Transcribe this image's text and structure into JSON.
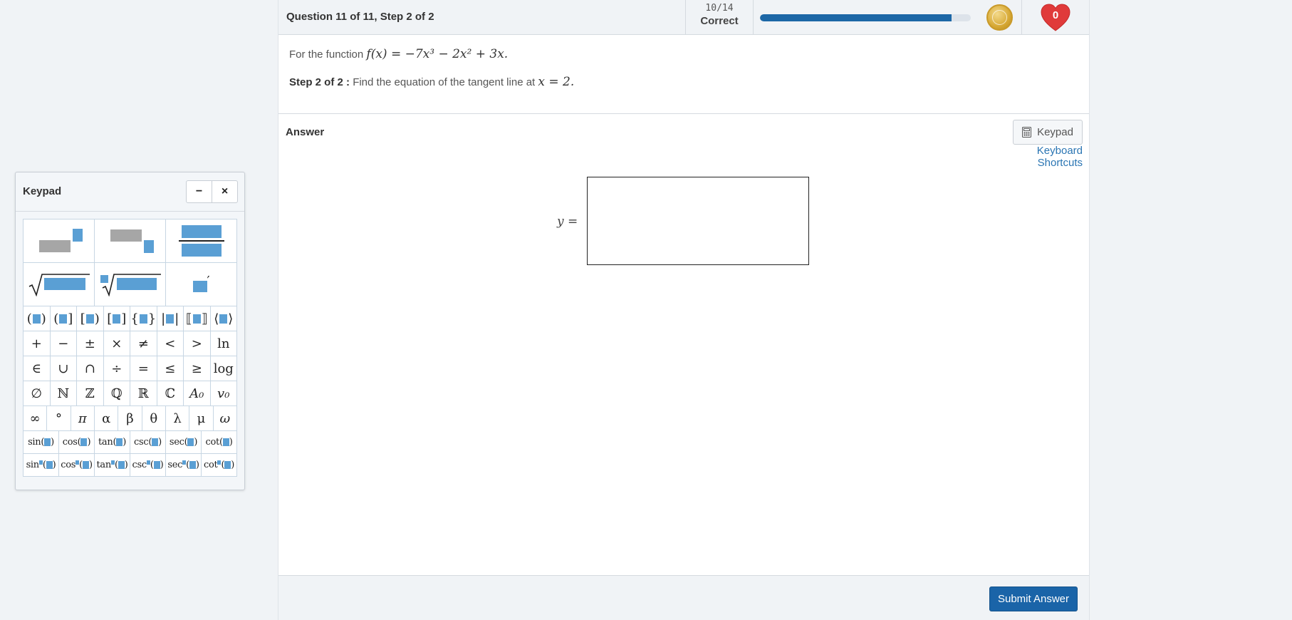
{
  "header": {
    "title": "Question 11 of 11, Step 2 of 2",
    "score_fraction": "10/14",
    "score_label": "Correct",
    "progress_fraction": 0.91,
    "heart_count": "0",
    "coin_icon": "coin-icon",
    "heart_icon": "heart-icon"
  },
  "question": {
    "intro": "For the function",
    "function": "f(x) = −7x³ − 2x² + 3x.",
    "step_label": "Step 2 of 2 :",
    "instruction": "Find the equation of the tangent line at",
    "point": "x = 2."
  },
  "answer": {
    "label": "Answer",
    "keypad_button": "Keypad",
    "shortcuts_link": "Keyboard Shortcuts",
    "lhs": "y ="
  },
  "footer": {
    "submit": "Submit Answer"
  },
  "keypad": {
    "title": "Keypad",
    "minimize": "−",
    "close": "×",
    "templates": [
      "superscript",
      "subscript",
      "fraction",
      "square-root",
      "nth-root",
      "prime"
    ],
    "parens_row": [
      "(■)",
      "(■]",
      "[■)",
      "[■]",
      "{■}",
      "|■|",
      "⟦■⟧",
      "⟨■⟩"
    ],
    "ops_row": [
      "+",
      "−",
      "±",
      "×",
      "≠",
      "<",
      ">",
      "ln"
    ],
    "sets_row": [
      "∈",
      "∪",
      "∩",
      "÷",
      "=",
      "≤",
      "≥",
      "log"
    ],
    "numbersets_row": [
      "∅",
      "ℕ",
      "ℤ",
      "ℚ",
      "ℝ",
      "ℂ",
      "A₀",
      "v₀"
    ],
    "greek_row": [
      "∞",
      "°",
      "π",
      "α",
      "β",
      "θ",
      "λ",
      "μ",
      "ω"
    ],
    "trig_row": [
      "sin",
      "cos",
      "tan",
      "csc",
      "sec",
      "cot"
    ],
    "trig_power_row": [
      "sin",
      "cos",
      "tan",
      "csc",
      "sec",
      "cot"
    ]
  },
  "colors": {
    "accent": "#1a64a8",
    "keypad_box": "#5a9fd4",
    "link": "#2a75b3",
    "heart": "#e03a3a",
    "coin": "#d7a935"
  }
}
